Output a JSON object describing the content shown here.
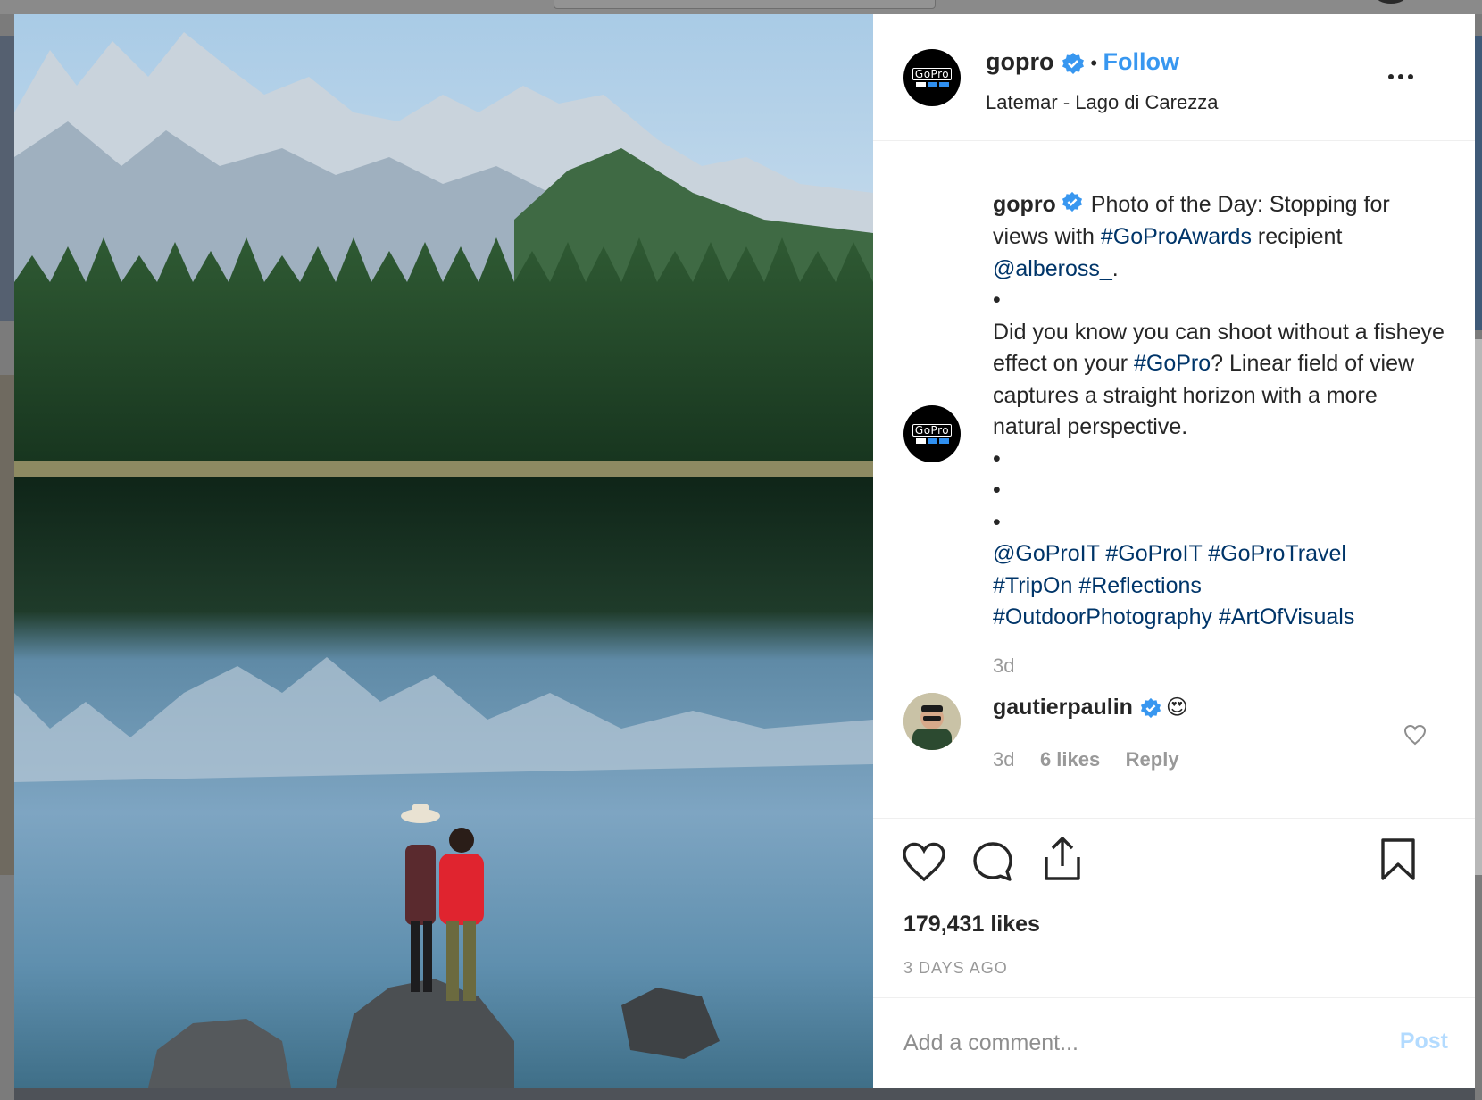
{
  "post": {
    "username": "gopro",
    "follow_label": "Follow",
    "separator": "•",
    "location": "Latemar - Lago di Carezza",
    "avatar_logo_text": "GoPro"
  },
  "caption": {
    "username": "gopro",
    "segments": [
      {
        "text": " Photo of the Day: Stopping for views with ",
        "link": false
      },
      {
        "text": "#GoProAwards",
        "link": true
      },
      {
        "text": " recipient ",
        "link": false
      },
      {
        "text": "@albeross_",
        "link": true
      },
      {
        "text": ".",
        "link": false
      }
    ],
    "bullet": "•",
    "paragraph2_segments": [
      {
        "text": "Did you know you can shoot without a fisheye effect on your ",
        "link": false
      },
      {
        "text": "#GoPro",
        "link": true
      },
      {
        "text": "? Linear field of view captures a straight horizon with a more natural perspective.",
        "link": false
      }
    ],
    "tags": [
      "@GoProIT",
      "#GoProIT",
      "#GoProTravel",
      "#TripOn",
      "#Reflections",
      "#OutdoorPhotography",
      "#ArtOfVisuals"
    ],
    "time": "3d"
  },
  "comment": {
    "username": "gautierpaulin",
    "emoji": "😍",
    "time": "3d",
    "likes": "6 likes",
    "reply_label": "Reply"
  },
  "stats": {
    "likes": "179,431 likes",
    "ago": "3 DAYS AGO"
  },
  "comment_box": {
    "placeholder": "Add a comment...",
    "post_label": "Post"
  },
  "colors": {
    "link": "#003569",
    "follow": "#3897f0",
    "verified": "#3897f0",
    "post_disabled": "#b3dbff",
    "muted": "#999999"
  },
  "icons": [
    "verified-badge-icon",
    "more-options-icon",
    "heart-icon",
    "comment-icon",
    "share-icon",
    "bookmark-icon",
    "comment-heart-icon"
  ]
}
